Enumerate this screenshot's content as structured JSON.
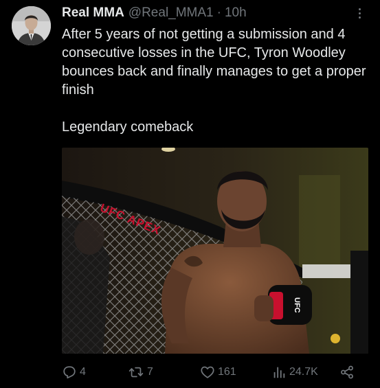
{
  "author": {
    "display_name": "Real MMA",
    "handle": "@Real_MMA1",
    "separator": "·",
    "time": "10h"
  },
  "tweet": {
    "text_paragraph_1": "After 5 years of not getting a submission and 4 consecutive losses in the UFC, Tyron Woodley bounces back and finally manages to get a proper finish",
    "text_paragraph_2": "Legendary comeback"
  },
  "media": {
    "banner_text": "UFC APEX",
    "glove_text": "UFC"
  },
  "actions": {
    "reply_count": "4",
    "repost_count": "7",
    "like_count": "161",
    "views_count": "24.7K"
  },
  "colors": {
    "background": "#000000",
    "text_primary": "#e7e9ea",
    "text_secondary": "#71767b",
    "glove_red": "#c8102e"
  },
  "icons": {
    "more": "more-dots-icon",
    "reply": "reply-bubble-icon",
    "repost": "repost-arrows-icon",
    "like": "heart-icon",
    "views": "views-bars-icon",
    "share": "share-icon"
  }
}
